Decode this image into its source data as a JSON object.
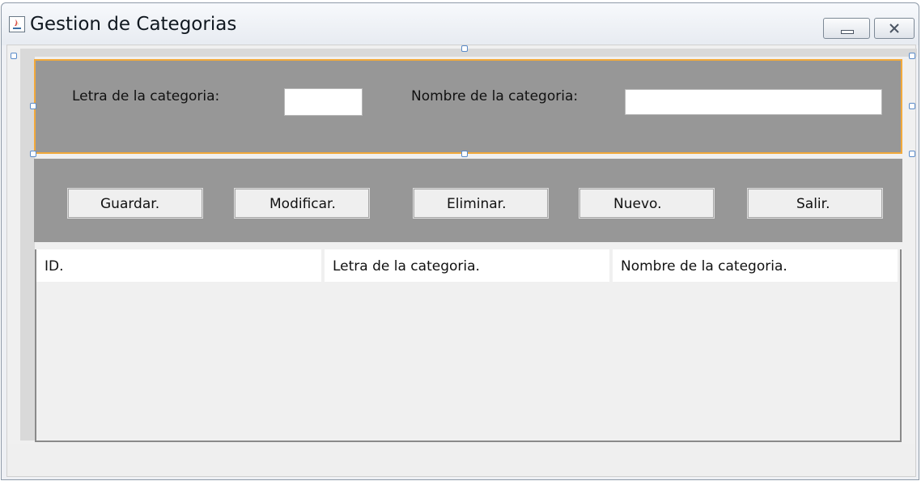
{
  "window": {
    "title": "Gestion de Categorias",
    "icon": "java-app-icon",
    "controls": [
      "minimize-icon",
      "close-icon"
    ]
  },
  "form": {
    "letra_label": "Letra de la categoria:",
    "letra_value": "",
    "nombre_label": "Nombre de la categoria:",
    "nombre_value": ""
  },
  "buttons": {
    "guardar": "Guardar.",
    "modificar": "Modificar.",
    "eliminar": "Eliminar.",
    "nuevo": "Nuevo.",
    "salir": "Salir."
  },
  "table": {
    "columns": [
      "ID.",
      "Letra de la categoria.",
      "Nombre de la categoria."
    ],
    "rows": []
  },
  "colors": {
    "panel": "#979797",
    "selection_border": "#f2a93b",
    "handle_border": "#5a8bc9"
  }
}
